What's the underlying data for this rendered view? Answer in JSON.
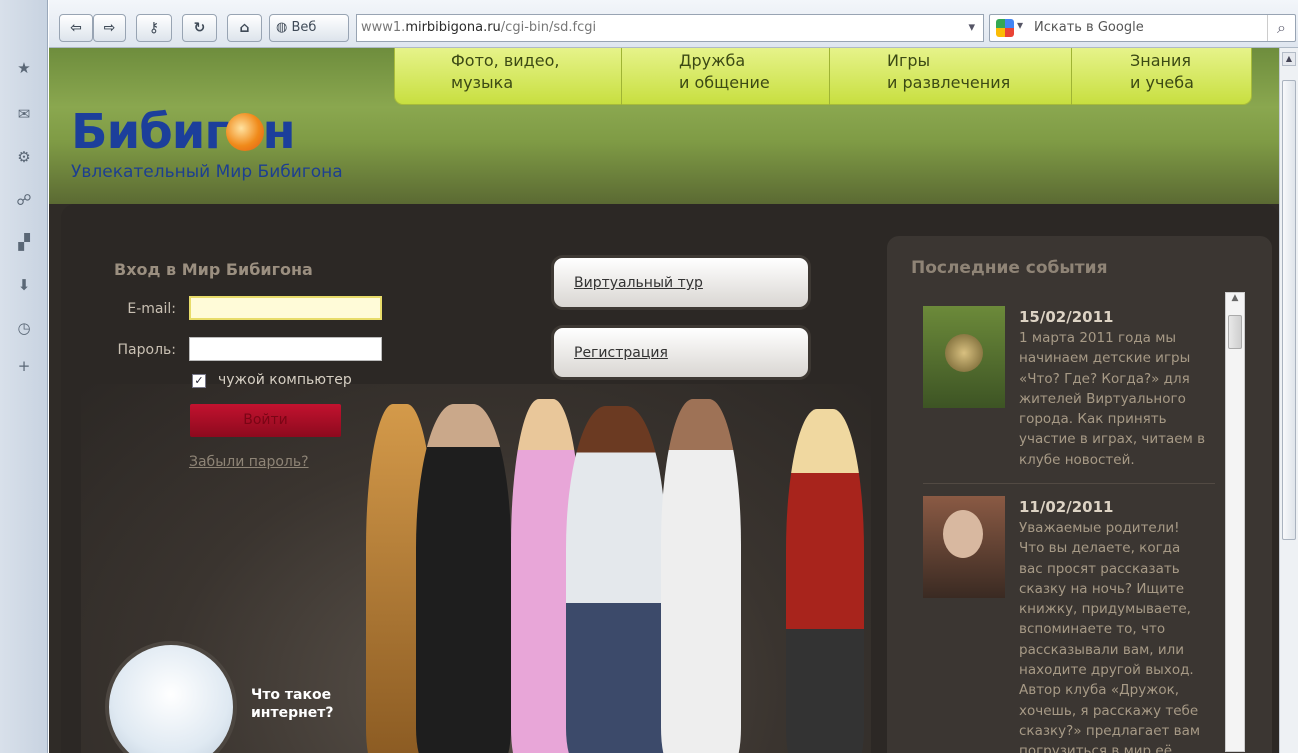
{
  "browser": {
    "address_host": "www1.",
    "address_domain": "mirbibigona.ru",
    "address_path": "/cgi-bin/sd.fcgi",
    "web_label": "Веб",
    "search_placeholder": "Искать в Google",
    "sidebar_icons": [
      "bookmarks-icon",
      "mail-icon",
      "widgets-icon",
      "feeds-icon",
      "notes-icon",
      "downloads-icon",
      "history-icon",
      "add-panel-icon"
    ]
  },
  "site": {
    "logo_text_left": "Бибиг",
    "logo_text_right": "н",
    "tagline": "Увлекательный Мир Бибигона",
    "nav": [
      {
        "line1": "Фото, видео,",
        "line2": "музыка"
      },
      {
        "line1": "Дружба",
        "line2": "и общение"
      },
      {
        "line1": "Игры",
        "line2": "и развлечения"
      },
      {
        "line1": "Знания",
        "line2": "и учеба"
      }
    ]
  },
  "login": {
    "title": "Вход в Мир Бибигона",
    "email_label": "E-mail:",
    "password_label": "Пароль:",
    "email_value": "",
    "password_value": "",
    "remember_label": "чужой компьютер",
    "remember_checked": true,
    "submit_label": "Войти",
    "forgot_label": "Забыли пароль?"
  },
  "buttons": {
    "tour": "Виртуальный тур",
    "register": "Регистрация"
  },
  "promo": {
    "line1": "Что такое",
    "line2": "интернет?"
  },
  "events": {
    "title": "Последние события",
    "items": [
      {
        "date": "15/02/2011",
        "lines": [
          "1 марта 2011 года мы",
          "начинаем детские игры",
          "«Что? Где? Когда?» для",
          "жителей Виртуального",
          "города. Как принять",
          "участие в играх, читаем в",
          "клубе новостей."
        ]
      },
      {
        "date": "11/02/2011",
        "lines": [
          "Уважаемые родители!",
          "Что вы делаете, когда",
          "вас просят рассказать",
          "сказку на ночь? Ищите",
          "книжку, придумываете,",
          "вспоминаете то, что",
          "рассказывали вам, или",
          "находите другой выход.",
          "Автор клуба «Дружок,",
          "хочешь, я расскажу тебе",
          "сказку?» предлагает вам",
          "погрузиться в мир её"
        ]
      }
    ]
  },
  "colors": {
    "accent_nav": "#d6e85a",
    "logo_blue": "#1c3f9b",
    "submit_red": "#a80e26"
  }
}
